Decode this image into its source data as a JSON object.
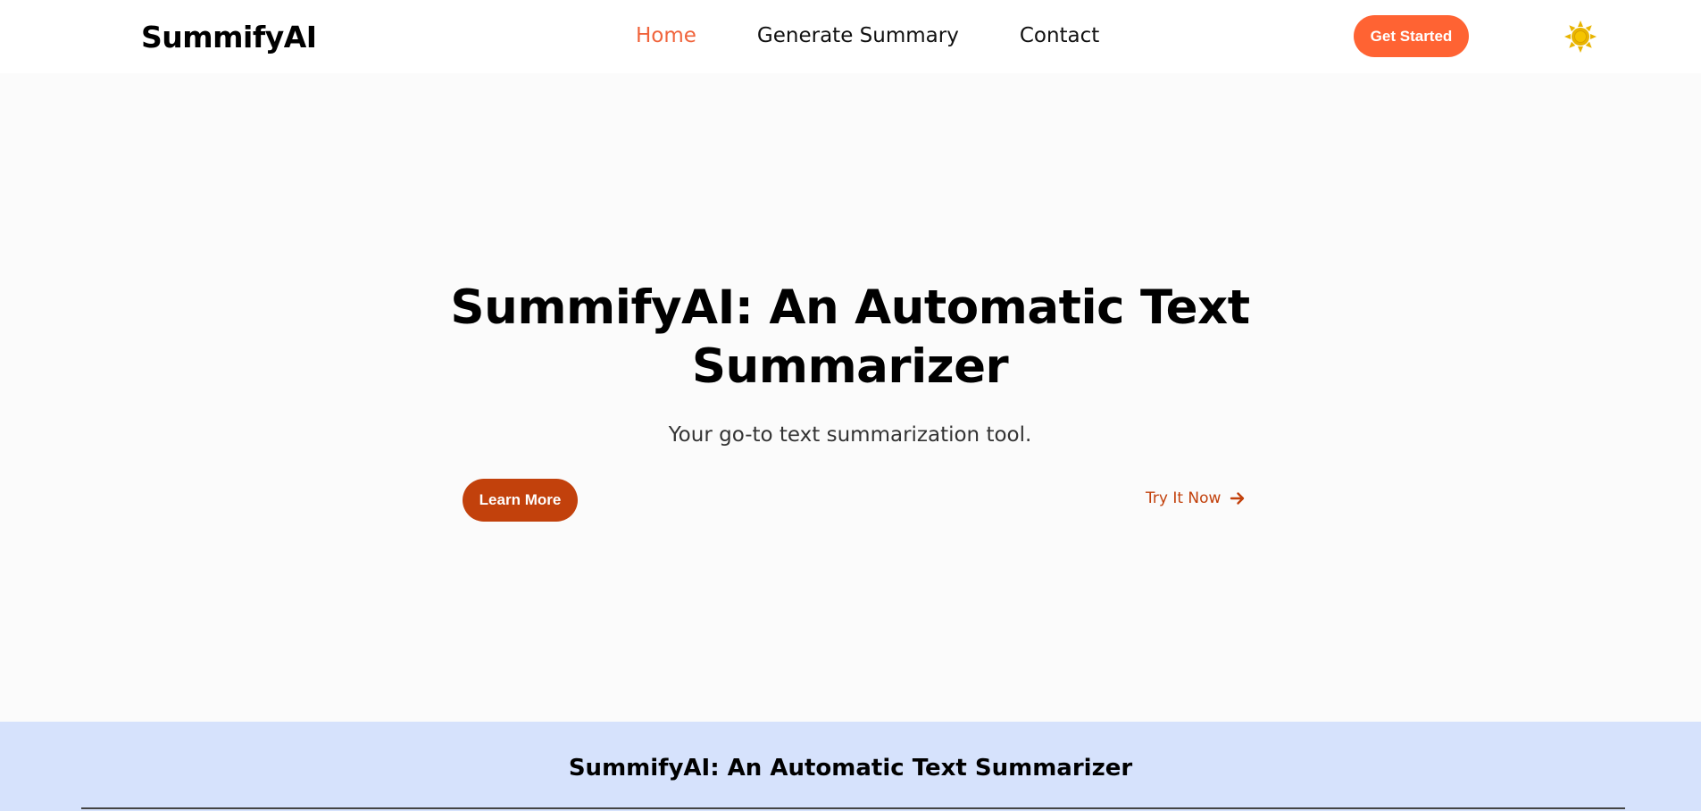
{
  "brand": {
    "name": "SummifyAI"
  },
  "nav": {
    "links": [
      {
        "label": "Home",
        "active": true
      },
      {
        "label": "Generate Summary",
        "active": false
      },
      {
        "label": "Contact",
        "active": false
      }
    ],
    "cta_label": "Get Started",
    "theme_icon": "sun-icon"
  },
  "hero": {
    "title": "SummifyAI: An Automatic Text Summarizer",
    "subtitle": "Your go-to text summarization tool.",
    "primary_button": "Learn More",
    "secondary_link": "Try It Now",
    "secondary_icon": "arrow-right-icon"
  },
  "footer": {
    "title": "SummifyAI: An Automatic Text Summarizer"
  },
  "colors": {
    "accent": "#ff6333",
    "accent_dark": "#c2410c",
    "active_link": "#f0643c",
    "sun": "#e8b400",
    "footer_bg": "#d6e2fc"
  }
}
